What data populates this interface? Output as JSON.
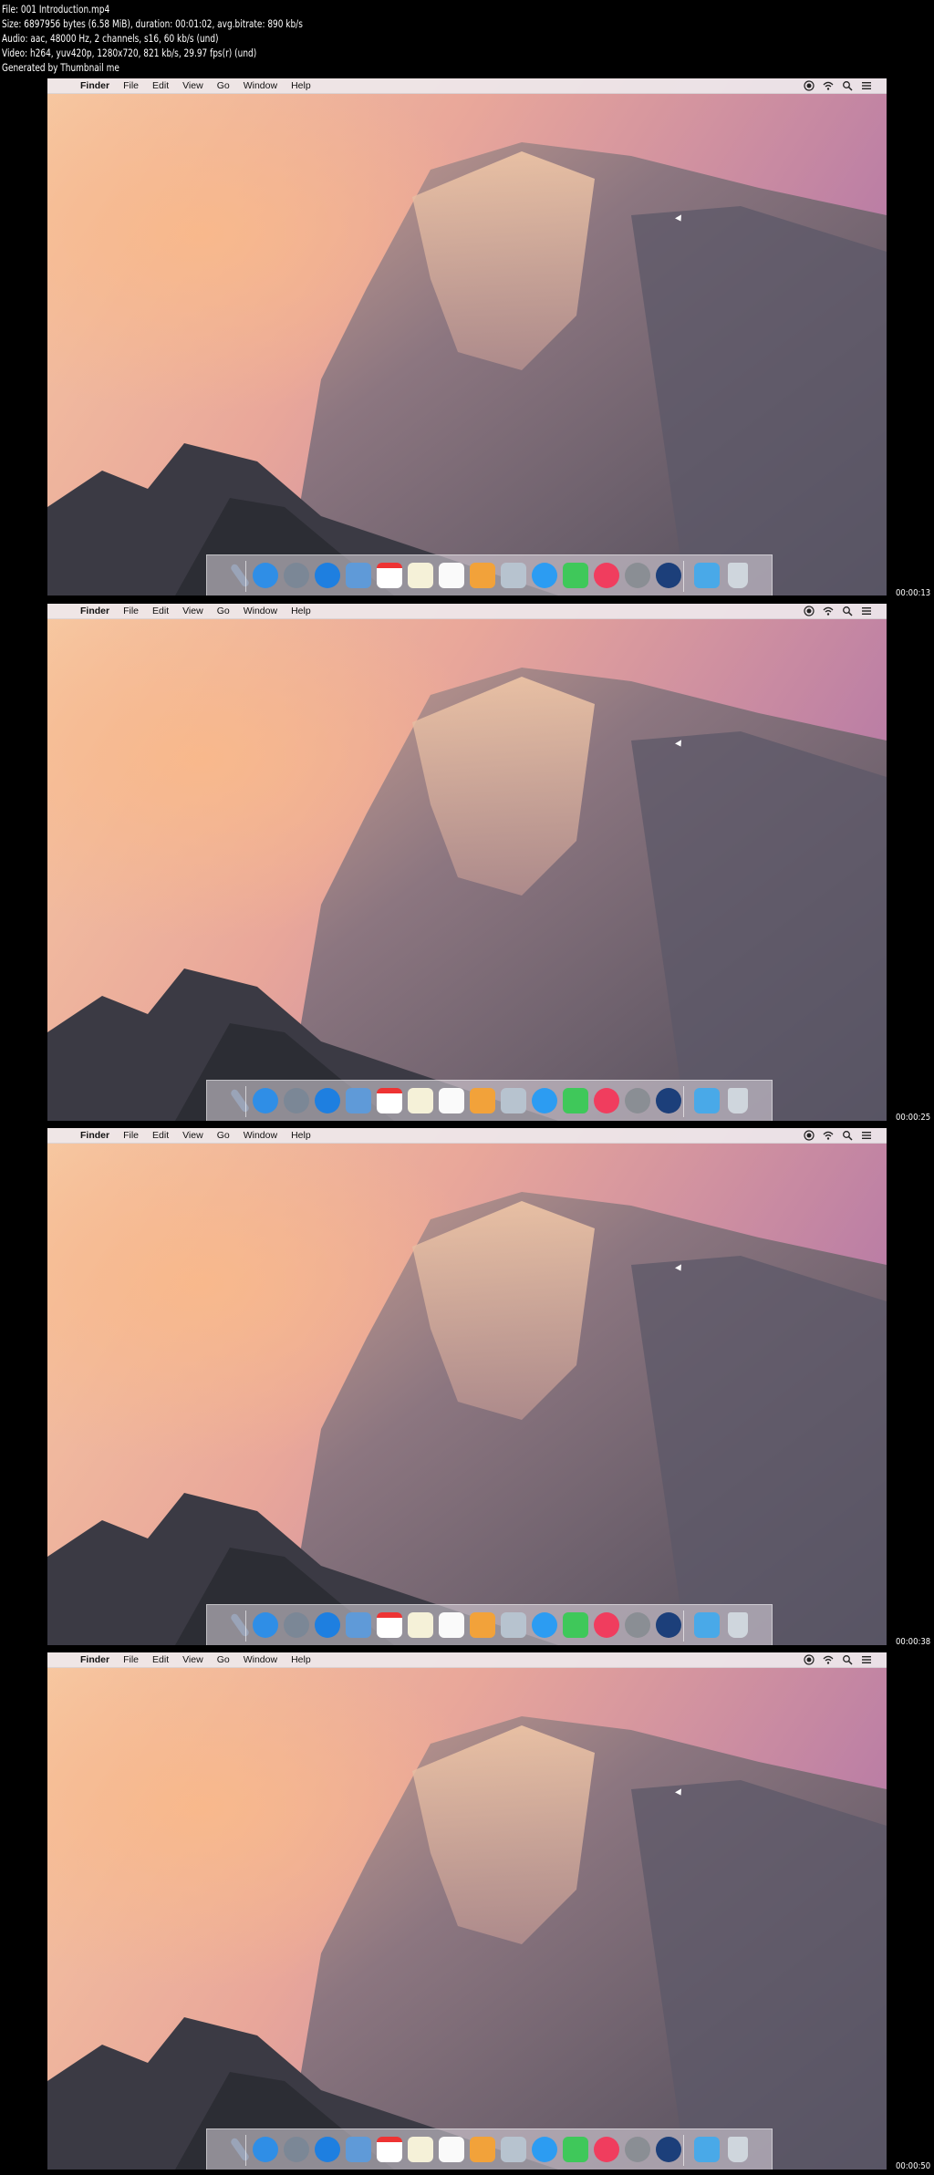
{
  "info": {
    "file": "File: 001 Introduction.mp4",
    "size": "Size: 6897956 bytes (6.58 MiB), duration: 00:01:02, avg.bitrate: 890 kb/s",
    "audio": "Audio: aac, 48000 Hz, 2 channels, s16, 60 kb/s (und)",
    "video": "Video: h264, yuv420p, 1280x720, 821 kb/s, 29.97 fps(r) (und)",
    "generator": "Generated by Thumbnail me"
  },
  "menubar": {
    "apple_glyph": "",
    "items": [
      "Finder",
      "File",
      "Edit",
      "View",
      "Go",
      "Window",
      "Help"
    ]
  },
  "timestamps": [
    "00:00:13",
    "00:00:25",
    "00:00:38",
    "00:00:50"
  ],
  "dock_icons": [
    "utilities-icon",
    "finder-icon",
    "launchpad-icon",
    "safari-icon",
    "mail-icon",
    "calendar-icon",
    "notes-icon",
    "reminders-icon",
    "sketch-icon",
    "preview-icon",
    "messages-icon",
    "facetime-icon",
    "itunes-icon",
    "system-preferences-icon",
    "quicktime-icon",
    "downloads-folder-icon",
    "trash-icon"
  ],
  "colors": {
    "menubar_bg": "#eee8ec",
    "sky_top": "#c67fa4",
    "sky_glow": "#f6b48c",
    "rock": "#6f6470"
  }
}
